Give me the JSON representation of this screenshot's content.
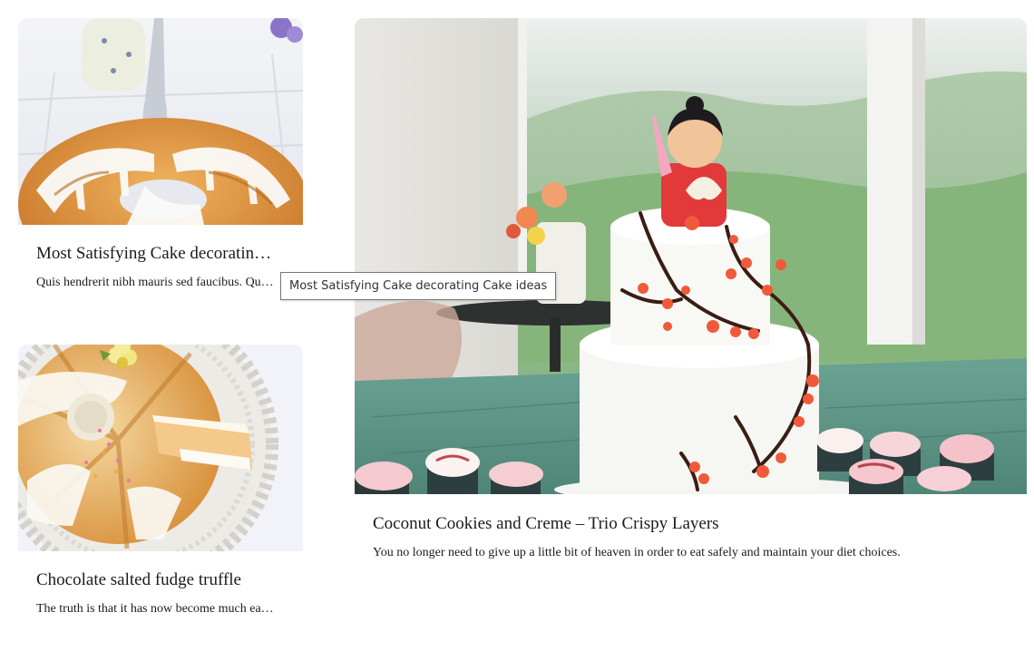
{
  "cards": [
    {
      "title": "Most Satisfying Cake decoratin…",
      "excerpt": "Quis hendrerit nibh mauris sed faucibus. Qu…"
    },
    {
      "title": "Chocolate salted fudge truffle",
      "excerpt": "The truth is that it has now become much ea…"
    },
    {
      "title": "Coconut Cookies and Creme – Trio Crispy Layers",
      "excerpt": "You no longer need to give up a little bit of heaven in order to eat safely and maintain your diet choices."
    }
  ],
  "tooltip": {
    "text": "Most Satisfying Cake decorating Cake ideas"
  },
  "colors": {
    "text": "#1b1b1b",
    "background": "#ffffff",
    "tooltip_border": "#767676"
  }
}
